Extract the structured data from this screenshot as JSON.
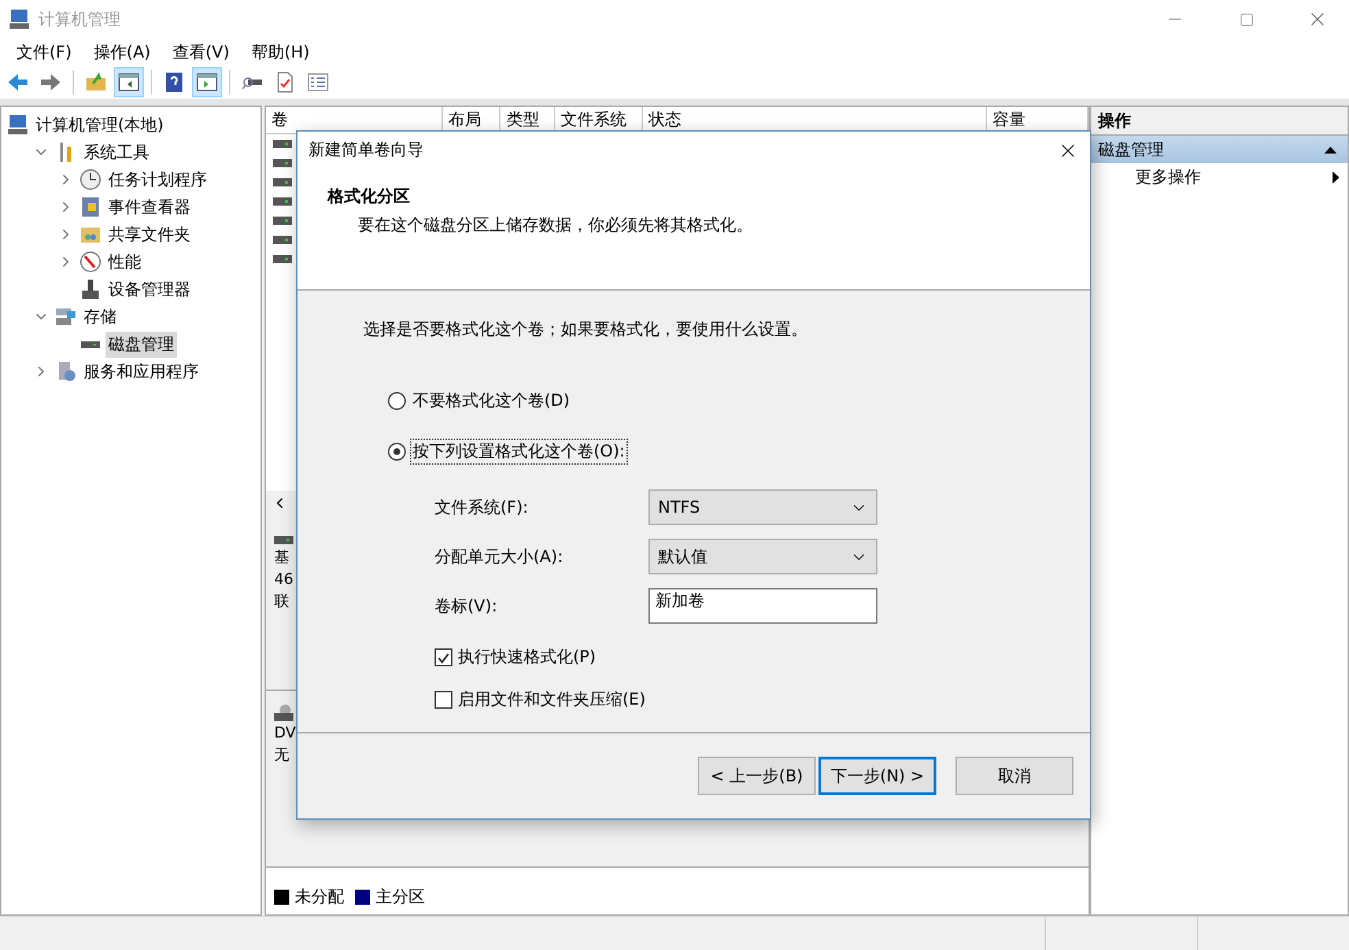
{
  "window": {
    "title": "计算机管理"
  },
  "menu": [
    "文件(F)",
    "操作(A)",
    "查看(V)",
    "帮助(H)"
  ],
  "toolbar": [
    {
      "kind": "back",
      "pressed": false
    },
    {
      "kind": "forward",
      "pressed": false
    },
    {
      "kind": "up",
      "pressed": false
    },
    {
      "kind": "tree",
      "pressed": true
    },
    {
      "kind": "help",
      "pressed": false
    },
    {
      "kind": "pane",
      "pressed": true
    },
    {
      "kind": "connect",
      "pressed": false
    },
    {
      "kind": "check",
      "pressed": false
    },
    {
      "kind": "list",
      "pressed": false
    }
  ],
  "tree": [
    {
      "label": "计算机管理(本地)",
      "selected": false,
      "children": [
        {
          "label": "系统工具",
          "expanded": true,
          "selected": false,
          "children": [
            {
              "label": "任务计划程序",
              "expanded": false,
              "selected": false
            },
            {
              "label": "事件查看器",
              "expanded": false,
              "selected": false
            },
            {
              "label": "共享文件夹",
              "expanded": false,
              "selected": false
            },
            {
              "label": "性能",
              "expanded": false,
              "selected": false
            },
            {
              "label": "设备管理器",
              "selected": false
            }
          ]
        },
        {
          "label": "存储",
          "expanded": true,
          "selected": false,
          "children": [
            {
              "label": "磁盘管理",
              "selected": true
            }
          ]
        },
        {
          "label": "服务和应用程序",
          "expanded": false,
          "selected": false
        }
      ]
    }
  ],
  "table": {
    "columns": [
      "卷",
      "布局",
      "类型",
      "文件系统",
      "状态",
      "容量"
    ]
  },
  "disks": [
    {
      "kind": "hdd",
      "lines": [
        "基",
        "46",
        "联"
      ]
    },
    {
      "kind": "dvd",
      "lines": [
        "DV",
        "无"
      ]
    }
  ],
  "legend": [
    {
      "label": "未分配",
      "color": "#000000"
    },
    {
      "label": "主分区",
      "color": "#000080"
    }
  ],
  "actions": {
    "title": "操作",
    "section": "磁盘管理",
    "items": [
      "更多操作"
    ]
  },
  "dialog": {
    "title": "新建简单卷向导",
    "heading": "格式化分区",
    "subtitle": "要在这个磁盘分区上储存数据，你必须先将其格式化。",
    "prompt": "选择是否要格式化这个卷；如果要格式化，要使用什么设置。",
    "options": [
      {
        "label": "不要格式化这个卷(D)",
        "selected": false
      },
      {
        "label": "按下列设置格式化这个卷(O):",
        "selected": true
      }
    ],
    "fields": [
      {
        "kind": "select",
        "label": "文件系统(F):",
        "value": "NTFS"
      },
      {
        "kind": "select",
        "label": "分配单元大小(A):",
        "value": "默认值"
      },
      {
        "kind": "text",
        "label": "卷标(V):",
        "value": "新加卷"
      }
    ],
    "checks": [
      {
        "label": "执行快速格式化(P)",
        "checked": true
      },
      {
        "label": "启用文件和文件夹压缩(E)",
        "checked": false
      }
    ],
    "buttons": [
      {
        "label": "< 上一步(B)",
        "kind": "normal"
      },
      {
        "label": "下一步(N) >",
        "kind": "default"
      },
      {
        "label": "取消",
        "kind": "normal"
      }
    ]
  }
}
